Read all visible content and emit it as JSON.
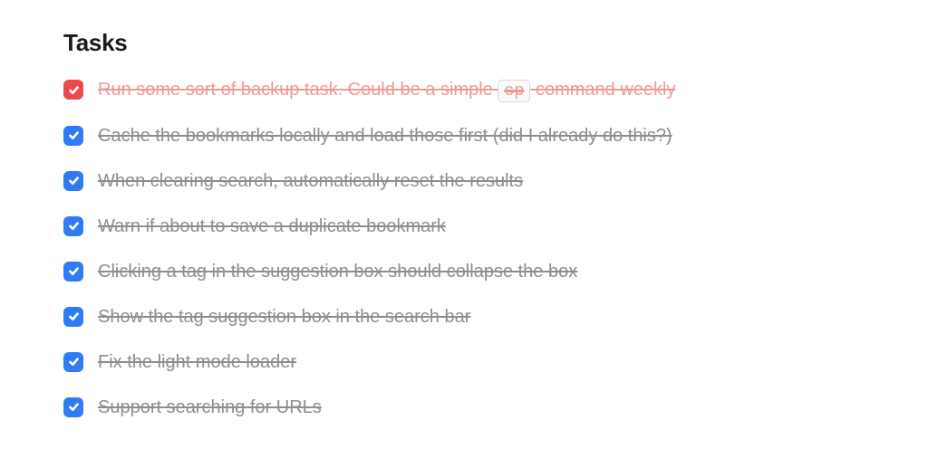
{
  "heading": "Tasks",
  "tasks": [
    {
      "checked": true,
      "color": "red",
      "text_before": "Run some sort of backup task. Could be a simple ",
      "code": "cp",
      "text_after": " command weekly"
    },
    {
      "checked": true,
      "color": "blue",
      "text": "Cache the bookmarks locally and load those first (did I already do this?)"
    },
    {
      "checked": true,
      "color": "blue",
      "text": "When clearing search, automatically reset the results"
    },
    {
      "checked": true,
      "color": "blue",
      "text": "Warn if about to save a duplicate bookmark"
    },
    {
      "checked": true,
      "color": "blue",
      "text": "Clicking a tag in the suggestion box should collapse the box"
    },
    {
      "checked": true,
      "color": "blue",
      "text": "Show the tag suggestion box in the search bar"
    },
    {
      "checked": true,
      "color": "blue",
      "text": "Fix the light mode loader"
    },
    {
      "checked": true,
      "color": "blue",
      "text": "Support searching for URLs"
    }
  ]
}
